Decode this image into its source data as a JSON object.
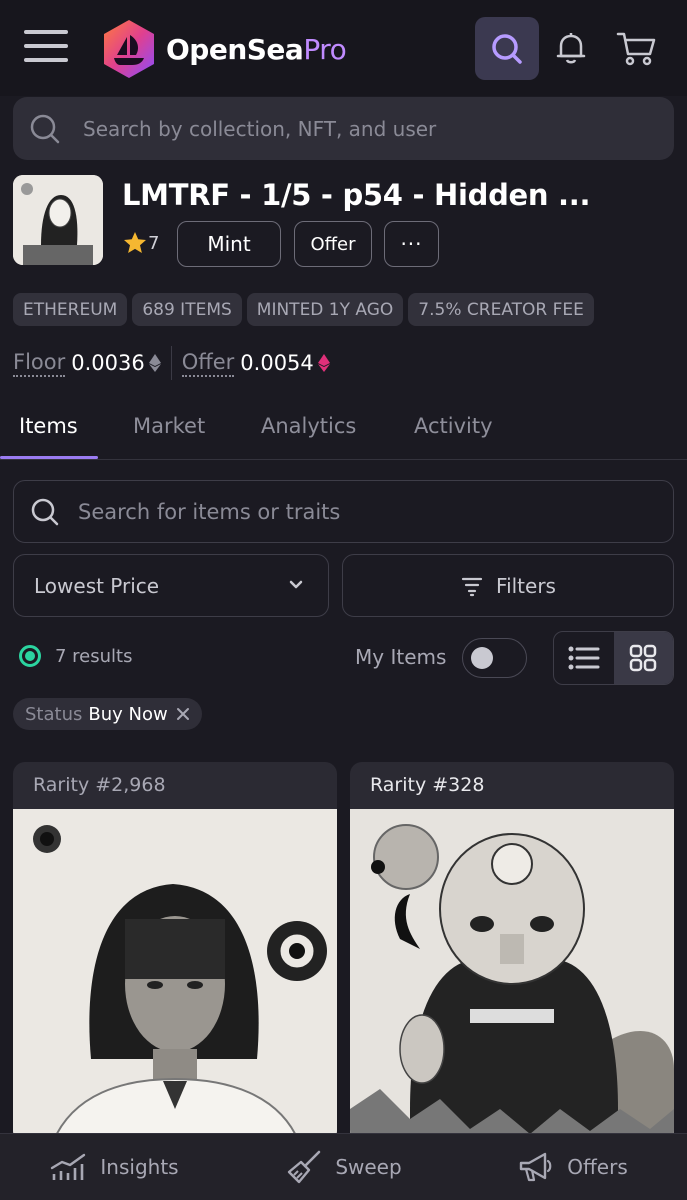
{
  "app": {
    "name": "OpenSea",
    "name_suffix": "Pro"
  },
  "header": {
    "global_search_placeholder": "Search by collection, NFT, and user"
  },
  "collection": {
    "title": "LMTRF - 1/5 - p54 - Hidden ...",
    "star_count": "7",
    "mint_label": "Mint",
    "offer_label": "Offer",
    "more_label": "···",
    "chips": [
      "ETHEREUM",
      "689 ITEMS",
      "MINTED 1Y AGO",
      "7.5% CREATOR FEE"
    ],
    "floor_label": "Floor",
    "floor_value": "0.0036",
    "offer_stat_label": "Offer",
    "offer_value": "0.0054"
  },
  "tabs": [
    "Items",
    "Market",
    "Analytics",
    "Activity"
  ],
  "items": {
    "search_placeholder": "Search for items or traits",
    "sort_value": "Lowest Price",
    "filters_label": "Filters",
    "results_text": "7 results",
    "my_items_label": "My Items",
    "status_filter_key": "Status",
    "status_filter_value": "Buy Now",
    "cards": [
      {
        "rarity": "Rarity #2,968"
      },
      {
        "rarity": "Rarity #328"
      }
    ]
  },
  "bottom_nav": [
    "Insights",
    "Sweep",
    "Offers"
  ],
  "colors": {
    "accent": "#9b7cf2",
    "live": "#2bd4a0",
    "offer_eth": "#e0307a"
  }
}
